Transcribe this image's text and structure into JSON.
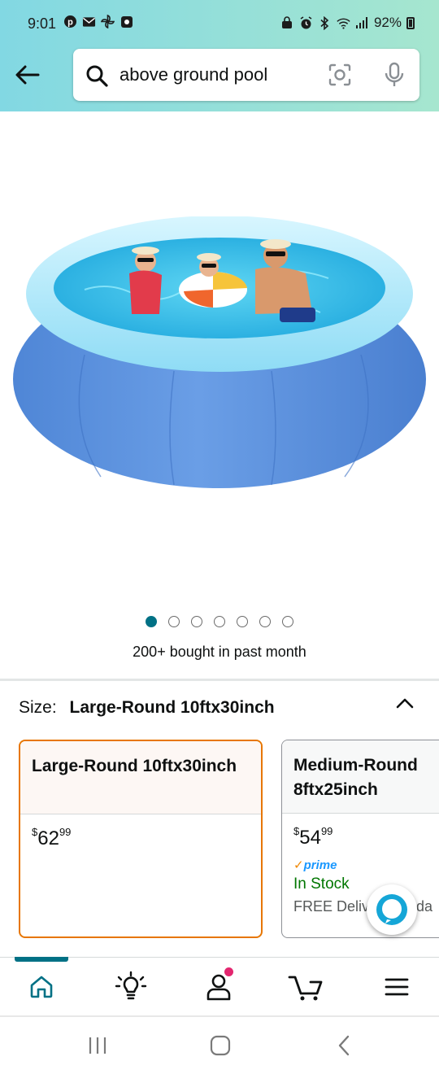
{
  "status_bar": {
    "time": "9:01",
    "battery": "92%",
    "left_icons": [
      "pinterest-icon",
      "mail-icon",
      "pinwheel-icon",
      "app-icon"
    ],
    "right_icons": [
      "lock-icon",
      "alarm-icon",
      "bluetooth-icon",
      "wifi-icon",
      "signal-icon",
      "battery-icon"
    ]
  },
  "search": {
    "query": "above ground pool"
  },
  "carousel": {
    "total": 7,
    "active_index": 0
  },
  "social_proof": "200+ bought in past month",
  "size_selector": {
    "label": "Size:",
    "selected": "Large-Round 10ftx30inch"
  },
  "options": [
    {
      "name": "Large-Round 10ftx30inch",
      "price_symbol": "$",
      "price_whole": "62",
      "price_fraction": "99"
    },
    {
      "name": "Medium-Round 8ftx25inch",
      "price_symbol": "$",
      "price_whole": "54",
      "price_fraction": "99",
      "prime": "prime",
      "stock": "In Stock",
      "delivery": "FREE Deliv",
      "delivery_suffix": "nda"
    }
  ],
  "bottom_nav": {
    "items": [
      "home-icon",
      "inspire-icon",
      "account-icon",
      "cart-icon",
      "menu-icon"
    ],
    "active": "home-icon"
  },
  "colors": {
    "header_gradient_start": "#82d8e3",
    "header_gradient_end": "#a6e6cf",
    "accent_teal": "#007185",
    "selected_border": "#e77600",
    "in_stock": "#007600",
    "prime_blue": "#1a98ff"
  }
}
